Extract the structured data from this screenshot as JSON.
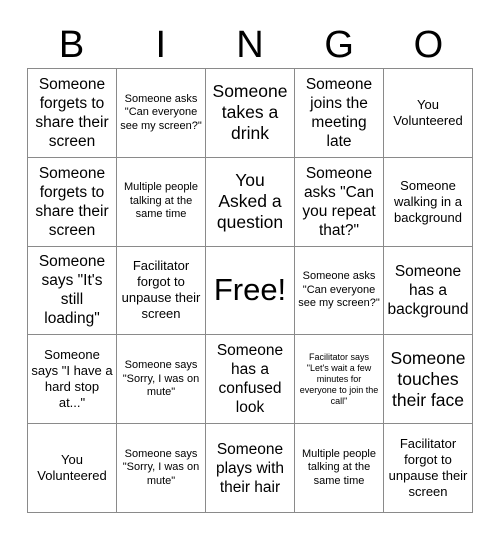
{
  "header": {
    "letters": [
      "B",
      "I",
      "N",
      "G",
      "O"
    ]
  },
  "grid": {
    "columns": 5,
    "rows": 5,
    "border_color": "#8a8a8a",
    "background_color": "#ffffff",
    "text_color": "#000000",
    "cells": [
      {
        "text": "Someone forgets to share their screen",
        "size": "lg"
      },
      {
        "text": "Someone asks \"Can everyone see my screen?\"",
        "size": "sm"
      },
      {
        "text": "Someone takes a drink",
        "size": "xl"
      },
      {
        "text": "Someone joins the meeting late",
        "size": "lg"
      },
      {
        "text": "You Volunteered",
        "size": "md"
      },
      {
        "text": "Someone forgets to share their screen",
        "size": "lg"
      },
      {
        "text": "Multiple people talking at the same time",
        "size": "sm"
      },
      {
        "text": "You Asked a question",
        "size": "xl"
      },
      {
        "text": "Someone asks \"Can you repeat that?\"",
        "size": "lg"
      },
      {
        "text": "Someone walking in a background",
        "size": "md"
      },
      {
        "text": "Someone says \"It's still loading\"",
        "size": "lg"
      },
      {
        "text": "Facilitator forgot to unpause their screen",
        "size": "md"
      },
      {
        "text": "Free!",
        "size": "free"
      },
      {
        "text": "Someone asks \"Can everyone see my screen?\"",
        "size": "sm"
      },
      {
        "text": "Someone has a background",
        "size": "lg"
      },
      {
        "text": "Someone says \"I have a hard stop at...\"",
        "size": "md"
      },
      {
        "text": "Someone says \"Sorry, I was on mute\"",
        "size": "sm"
      },
      {
        "text": "Someone has a confused look",
        "size": "lg"
      },
      {
        "text": "Facilitator says \"Let's wait a few minutes for everyone to join the call\"",
        "size": "xs"
      },
      {
        "text": "Someone touches their face",
        "size": "xl"
      },
      {
        "text": "You Volunteered",
        "size": "md"
      },
      {
        "text": "Someone says \"Sorry, I was on mute\"",
        "size": "sm"
      },
      {
        "text": "Someone plays with their hair",
        "size": "lg"
      },
      {
        "text": "Multiple people talking at the same time",
        "size": "sm"
      },
      {
        "text": "Facilitator forgot to unpause their screen",
        "size": "md"
      }
    ]
  }
}
